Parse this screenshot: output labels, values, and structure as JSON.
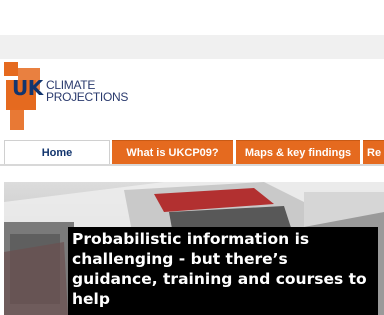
{
  "logo": {
    "uk_mark": "UK",
    "line1": "CLIMATE",
    "line2": "PROJECTIONS"
  },
  "nav": {
    "tabs": [
      {
        "label": "Home",
        "active": true
      },
      {
        "label": "What is UKCP09?",
        "active": false
      },
      {
        "label": "Maps & key findings",
        "active": false
      },
      {
        "label": "Re",
        "active": false
      }
    ]
  },
  "hero": {
    "caption": "Probabilistic information is challenging - but there’s guidance, training and courses to help"
  },
  "colors": {
    "brand_orange": "#e56a1f",
    "brand_navy": "#12356e",
    "caption_bg": "#000000"
  }
}
